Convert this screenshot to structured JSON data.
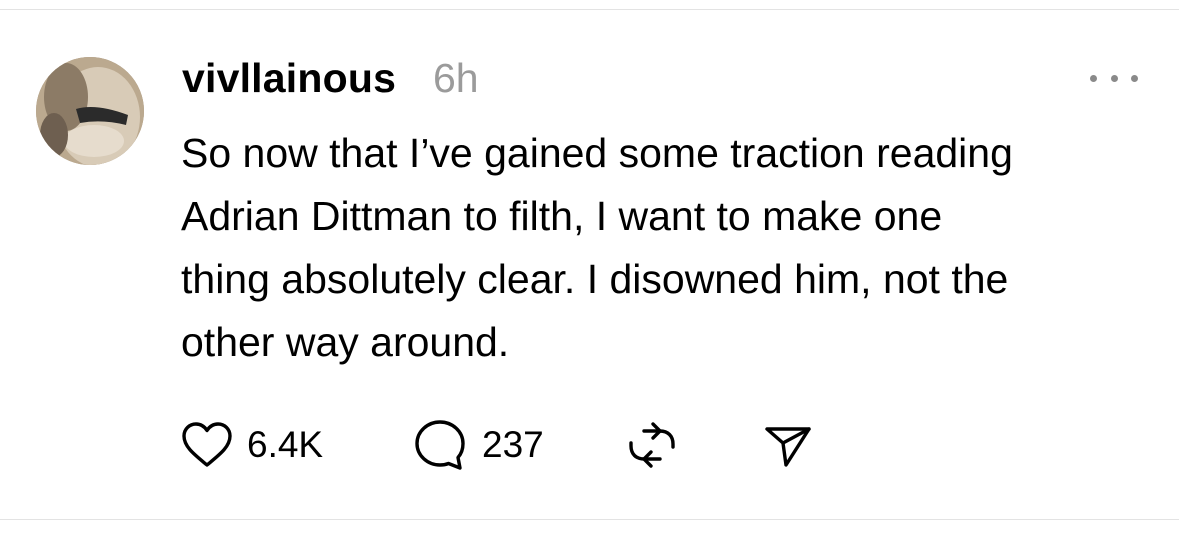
{
  "post": {
    "username": "vivllainous",
    "timestamp": "6h",
    "text": "So now that I’ve gained some traction reading Adrian Dittman to filth, I want to make one thing absolutely clear. I disowned him, not the other way around.",
    "lines": [
      "So now that I’ve gained some traction reading",
      "Adrian Dittman to filth, I want to make one",
      "thing absolutely clear. I disowned him, not the",
      "other way around."
    ]
  },
  "actions": {
    "likes": "6.4K",
    "comments": "237",
    "like_icon": "heart-icon",
    "comment_icon": "comment-bubble-icon",
    "repost_icon": "repost-icon",
    "share_icon": "send-icon",
    "more_icon": "more-dots-icon"
  },
  "colors": {
    "text": "#000000",
    "muted": "#9b9b9b",
    "divider": "#e3e3e3",
    "background": "#ffffff"
  }
}
